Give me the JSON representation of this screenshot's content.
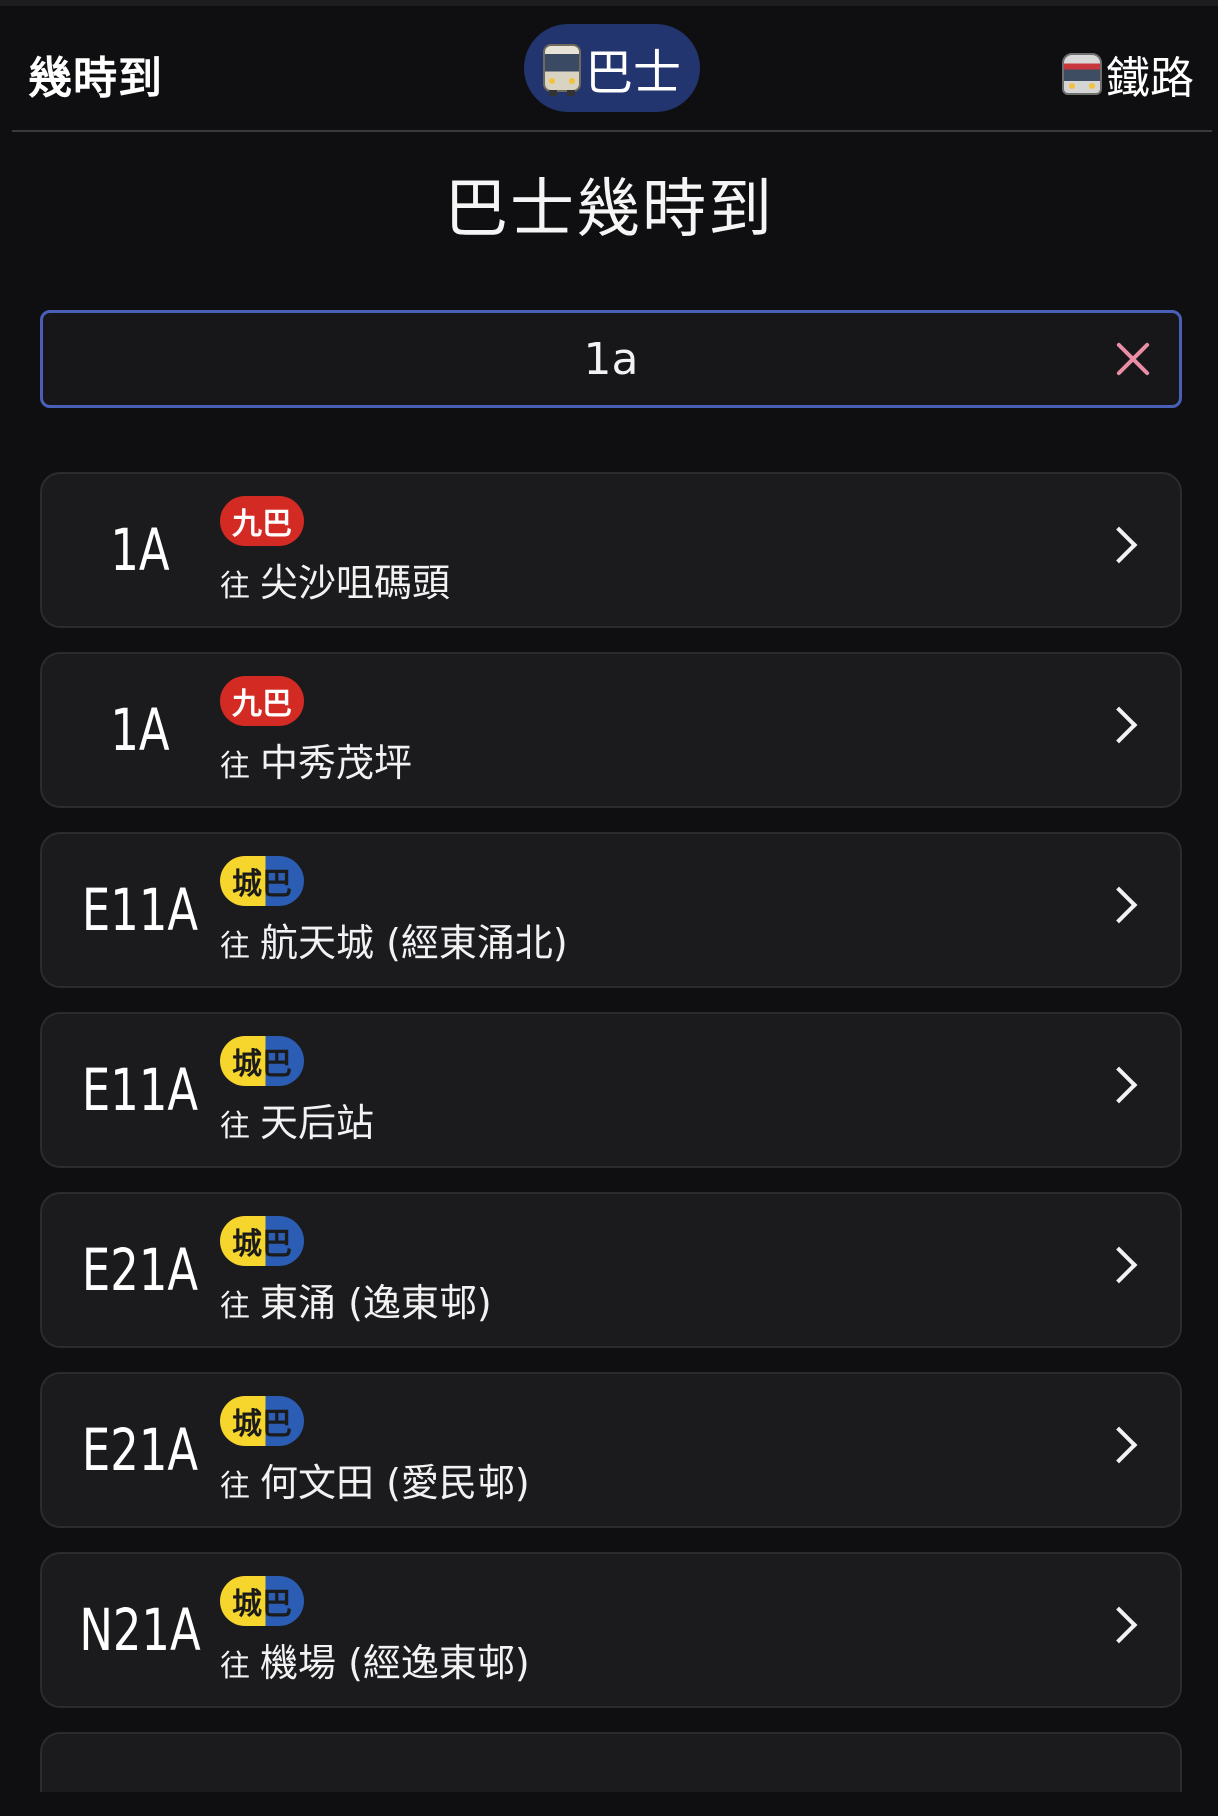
{
  "header": {
    "app_title": "幾時到",
    "tab_bus_label": "巴士",
    "tab_rail_label": "鐵路"
  },
  "page_title": "巴士幾時到",
  "search": {
    "value": "1a"
  },
  "results": [
    {
      "route": "1A",
      "operator": "九巴",
      "operator_type": "kmb",
      "to": "往",
      "destination": "尖沙咀碼頭"
    },
    {
      "route": "1A",
      "operator": "九巴",
      "operator_type": "kmb",
      "to": "往",
      "destination": "中秀茂坪"
    },
    {
      "route": "E11A",
      "operator": "城巴",
      "operator_type": "ctb",
      "to": "往",
      "destination": "航天城 (經東涌北)"
    },
    {
      "route": "E11A",
      "operator": "城巴",
      "operator_type": "ctb",
      "to": "往",
      "destination": "天后站"
    },
    {
      "route": "E21A",
      "operator": "城巴",
      "operator_type": "ctb",
      "to": "往",
      "destination": "東涌 (逸東邨)"
    },
    {
      "route": "E21A",
      "operator": "城巴",
      "operator_type": "ctb",
      "to": "往",
      "destination": "何文田 (愛民邨)"
    },
    {
      "route": "N21A",
      "operator": "城巴",
      "operator_type": "ctb",
      "to": "往",
      "destination": "機場 (經逸東邨)"
    }
  ],
  "colors": {
    "background": "#0f0f11",
    "card": "#1b1b1e",
    "accent": "#4a5fb8",
    "tab_active": "#23356f",
    "kmb_red": "#d42a24",
    "ctb_yellow": "#f6d52c",
    "ctb_blue": "#2a5db3",
    "clear_icon": "#e98ea4"
  },
  "icons": {
    "bus_tab": "bus-icon",
    "rail_tab": "rail-icon",
    "clear": "close-icon",
    "row_action": "chevron-right-icon"
  }
}
